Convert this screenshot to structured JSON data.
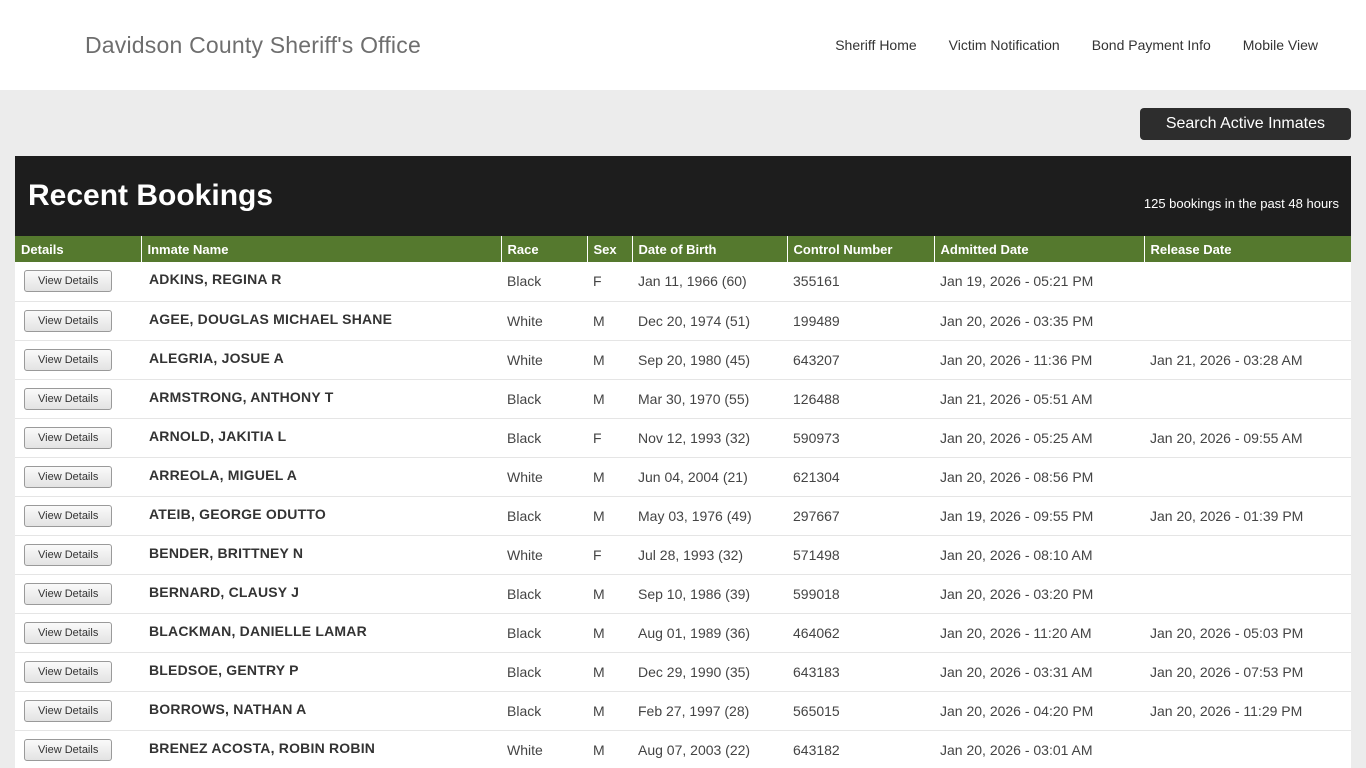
{
  "header": {
    "title": "Davidson County Sheriff's Office",
    "nav": [
      {
        "label": "Sheriff Home"
      },
      {
        "label": "Victim Notification"
      },
      {
        "label": "Bond Payment Info"
      },
      {
        "label": "Mobile View"
      }
    ]
  },
  "search": {
    "button_label": "Search Active Inmates"
  },
  "bookings": {
    "title": "Recent Bookings",
    "subtitle": "125 bookings in the past 48 hours",
    "view_details_label": "View Details",
    "columns": [
      "Details",
      "Inmate Name",
      "Race",
      "Sex",
      "Date of Birth",
      "Control Number",
      "Admitted Date",
      "Release Date"
    ],
    "rows": [
      {
        "name": "ADKINS, REGINA  R",
        "race": "Black",
        "sex": "F",
        "dob": "Jan 11, 1966 (60)",
        "control": "355161",
        "admitted": "Jan 19, 2026 - 05:21 PM",
        "released": ""
      },
      {
        "name": "AGEE, DOUGLAS  MICHAEL SHANE",
        "race": "White",
        "sex": "M",
        "dob": "Dec 20, 1974 (51)",
        "control": "199489",
        "admitted": "Jan 20, 2026 - 03:35 PM",
        "released": ""
      },
      {
        "name": "ALEGRIA, JOSUE  A",
        "race": "White",
        "sex": "M",
        "dob": "Sep 20, 1980 (45)",
        "control": "643207",
        "admitted": "Jan 20, 2026 - 11:36 PM",
        "released": "Jan 21, 2026 - 03:28 AM"
      },
      {
        "name": "ARMSTRONG, ANTHONY  T",
        "race": "Black",
        "sex": "M",
        "dob": "Mar 30, 1970 (55)",
        "control": "126488",
        "admitted": "Jan 21, 2026 - 05:51 AM",
        "released": ""
      },
      {
        "name": "ARNOLD, JAKITIA  L",
        "race": "Black",
        "sex": "F",
        "dob": "Nov 12, 1993 (32)",
        "control": "590973",
        "admitted": "Jan 20, 2026 - 05:25 AM",
        "released": "Jan 20, 2026 - 09:55 AM"
      },
      {
        "name": "ARREOLA, MIGUEL  A",
        "race": "White",
        "sex": "M",
        "dob": "Jun 04, 2004 (21)",
        "control": "621304",
        "admitted": "Jan 20, 2026 - 08:56 PM",
        "released": ""
      },
      {
        "name": "ATEIB, GEORGE  ODUTTO",
        "race": "Black",
        "sex": "M",
        "dob": "May 03, 1976 (49)",
        "control": "297667",
        "admitted": "Jan 19, 2026 - 09:55 PM",
        "released": "Jan 20, 2026 - 01:39 PM"
      },
      {
        "name": "BENDER, BRITTNEY  N",
        "race": "White",
        "sex": "F",
        "dob": "Jul 28, 1993 (32)",
        "control": "571498",
        "admitted": "Jan 20, 2026 - 08:10 AM",
        "released": ""
      },
      {
        "name": "BERNARD, CLAUSY  J",
        "race": "Black",
        "sex": "M",
        "dob": "Sep 10, 1986 (39)",
        "control": "599018",
        "admitted": "Jan 20, 2026 - 03:20 PM",
        "released": ""
      },
      {
        "name": "BLACKMAN, DANIELLE  LAMAR",
        "race": "Black",
        "sex": "M",
        "dob": "Aug 01, 1989 (36)",
        "control": "464062",
        "admitted": "Jan 20, 2026 - 11:20 AM",
        "released": "Jan 20, 2026 - 05:03 PM"
      },
      {
        "name": "BLEDSOE, GENTRY  P",
        "race": "Black",
        "sex": "M",
        "dob": "Dec 29, 1990 (35)",
        "control": "643183",
        "admitted": "Jan 20, 2026 - 03:31 AM",
        "released": "Jan 20, 2026 - 07:53 PM"
      },
      {
        "name": "BORROWS, NATHAN  A",
        "race": "Black",
        "sex": "M",
        "dob": "Feb 27, 1997 (28)",
        "control": "565015",
        "admitted": "Jan 20, 2026 - 04:20 PM",
        "released": "Jan 20, 2026 - 11:29 PM"
      },
      {
        "name": "BRENEZ ACOSTA, ROBIN  ROBIN",
        "race": "White",
        "sex": "M",
        "dob": "Aug 07, 2003 (22)",
        "control": "643182",
        "admitted": "Jan 20, 2026 - 03:01 AM",
        "released": ""
      }
    ]
  },
  "colors": {
    "table_header_green": "#55792e",
    "dark_bar": "#1d1d1d",
    "search_button": "#2d2d2d",
    "page_background": "#ececec"
  }
}
